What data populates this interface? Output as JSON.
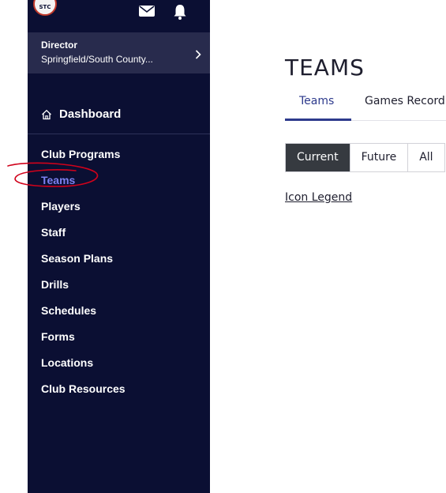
{
  "logo": {
    "text": "STC"
  },
  "topbar": {
    "icons": [
      "mail-icon",
      "bell-icon"
    ]
  },
  "role": {
    "title": "Director",
    "org": "Springfield/South County..."
  },
  "sidebar": {
    "dashboard_label": "Dashboard",
    "items": [
      {
        "label": "Club Programs"
      },
      {
        "label": "Teams"
      },
      {
        "label": "Players"
      },
      {
        "label": "Staff"
      },
      {
        "label": "Season Plans"
      },
      {
        "label": "Drills"
      },
      {
        "label": "Schedules"
      },
      {
        "label": "Forms"
      },
      {
        "label": "Locations"
      },
      {
        "label": "Club Resources"
      }
    ],
    "active_item": "Teams"
  },
  "main": {
    "title": "TEAMS",
    "tabs": [
      {
        "label": "Teams"
      },
      {
        "label": "Games Record"
      }
    ],
    "filters": [
      {
        "label": "Current"
      },
      {
        "label": "Future"
      },
      {
        "label": "All"
      }
    ],
    "selected_filter": "Current",
    "legend_link": "Icon Legend"
  },
  "colors": {
    "sidebar_bg": "#0b0f33",
    "role_panel_bg": "#282b4d",
    "active_nav": "#7d80f0",
    "tab_accent": "#2d3a8c",
    "filter_selected_bg": "#363a40",
    "annotation": "#d0021b"
  }
}
